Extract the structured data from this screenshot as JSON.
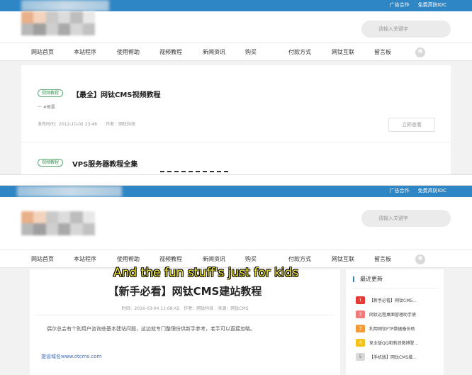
{
  "top_links": [
    "广告合作",
    "免费高防IDC"
  ],
  "search_placeholder": "请输入关键字",
  "nav_items": [
    "网站首页",
    "本站程序",
    "使用帮助",
    "视频教程",
    "新闻资讯",
    "购买",
    "付款方式",
    "网钛互联",
    "留言板"
  ],
  "list_view": {
    "articles": [
      {
        "tag": "视频教程",
        "title": "【最全】网钛CMS视频教程",
        "snippet": "一 #概要",
        "meta": "发布时间：2012-10-02 23:46　　作者：网钛科技",
        "read_more": "立即查看"
      },
      {
        "tag": "视频教程",
        "title": "VPS服务器教程全集"
      }
    ]
  },
  "detail_view": {
    "title": "【新手必看】网钛CMS建站教程",
    "meta": "时间：2016-03-04 11:08:42　作者：网钛科技　来源：网钛CMS",
    "paragraph": "偶尔总会有个别用户咨询些基本建站问题，这边就专门整理份供新手参考，老手可以直接忽略。",
    "footer_link": "提设域名www.otcms.com",
    "subtitle": "And the fun stuff's just for kids"
  },
  "sidebar": {
    "title": "最近更新",
    "items": [
      {
        "num": "1",
        "text": "【新手必看】网钛CMS...",
        "color": "#e53935"
      },
      {
        "num": "2",
        "text": "网钛远程桌面管理助手使",
        "color": "#ef7b7b"
      },
      {
        "num": "3",
        "text": "利用网钛FTP数据备份助",
        "color": "#f39a3a"
      },
      {
        "num": "4",
        "text": "竞业版QQ和新浪微博登...",
        "color": "#f4c21b"
      },
      {
        "num": "5",
        "text": "【手机版】网钛CMS增...",
        "color": "#d9d9d9"
      }
    ]
  },
  "colors": {
    "topbar": "#2f86c4",
    "tag_border": "#5aa870"
  },
  "icons": [
    "user-avatar-icon"
  ]
}
